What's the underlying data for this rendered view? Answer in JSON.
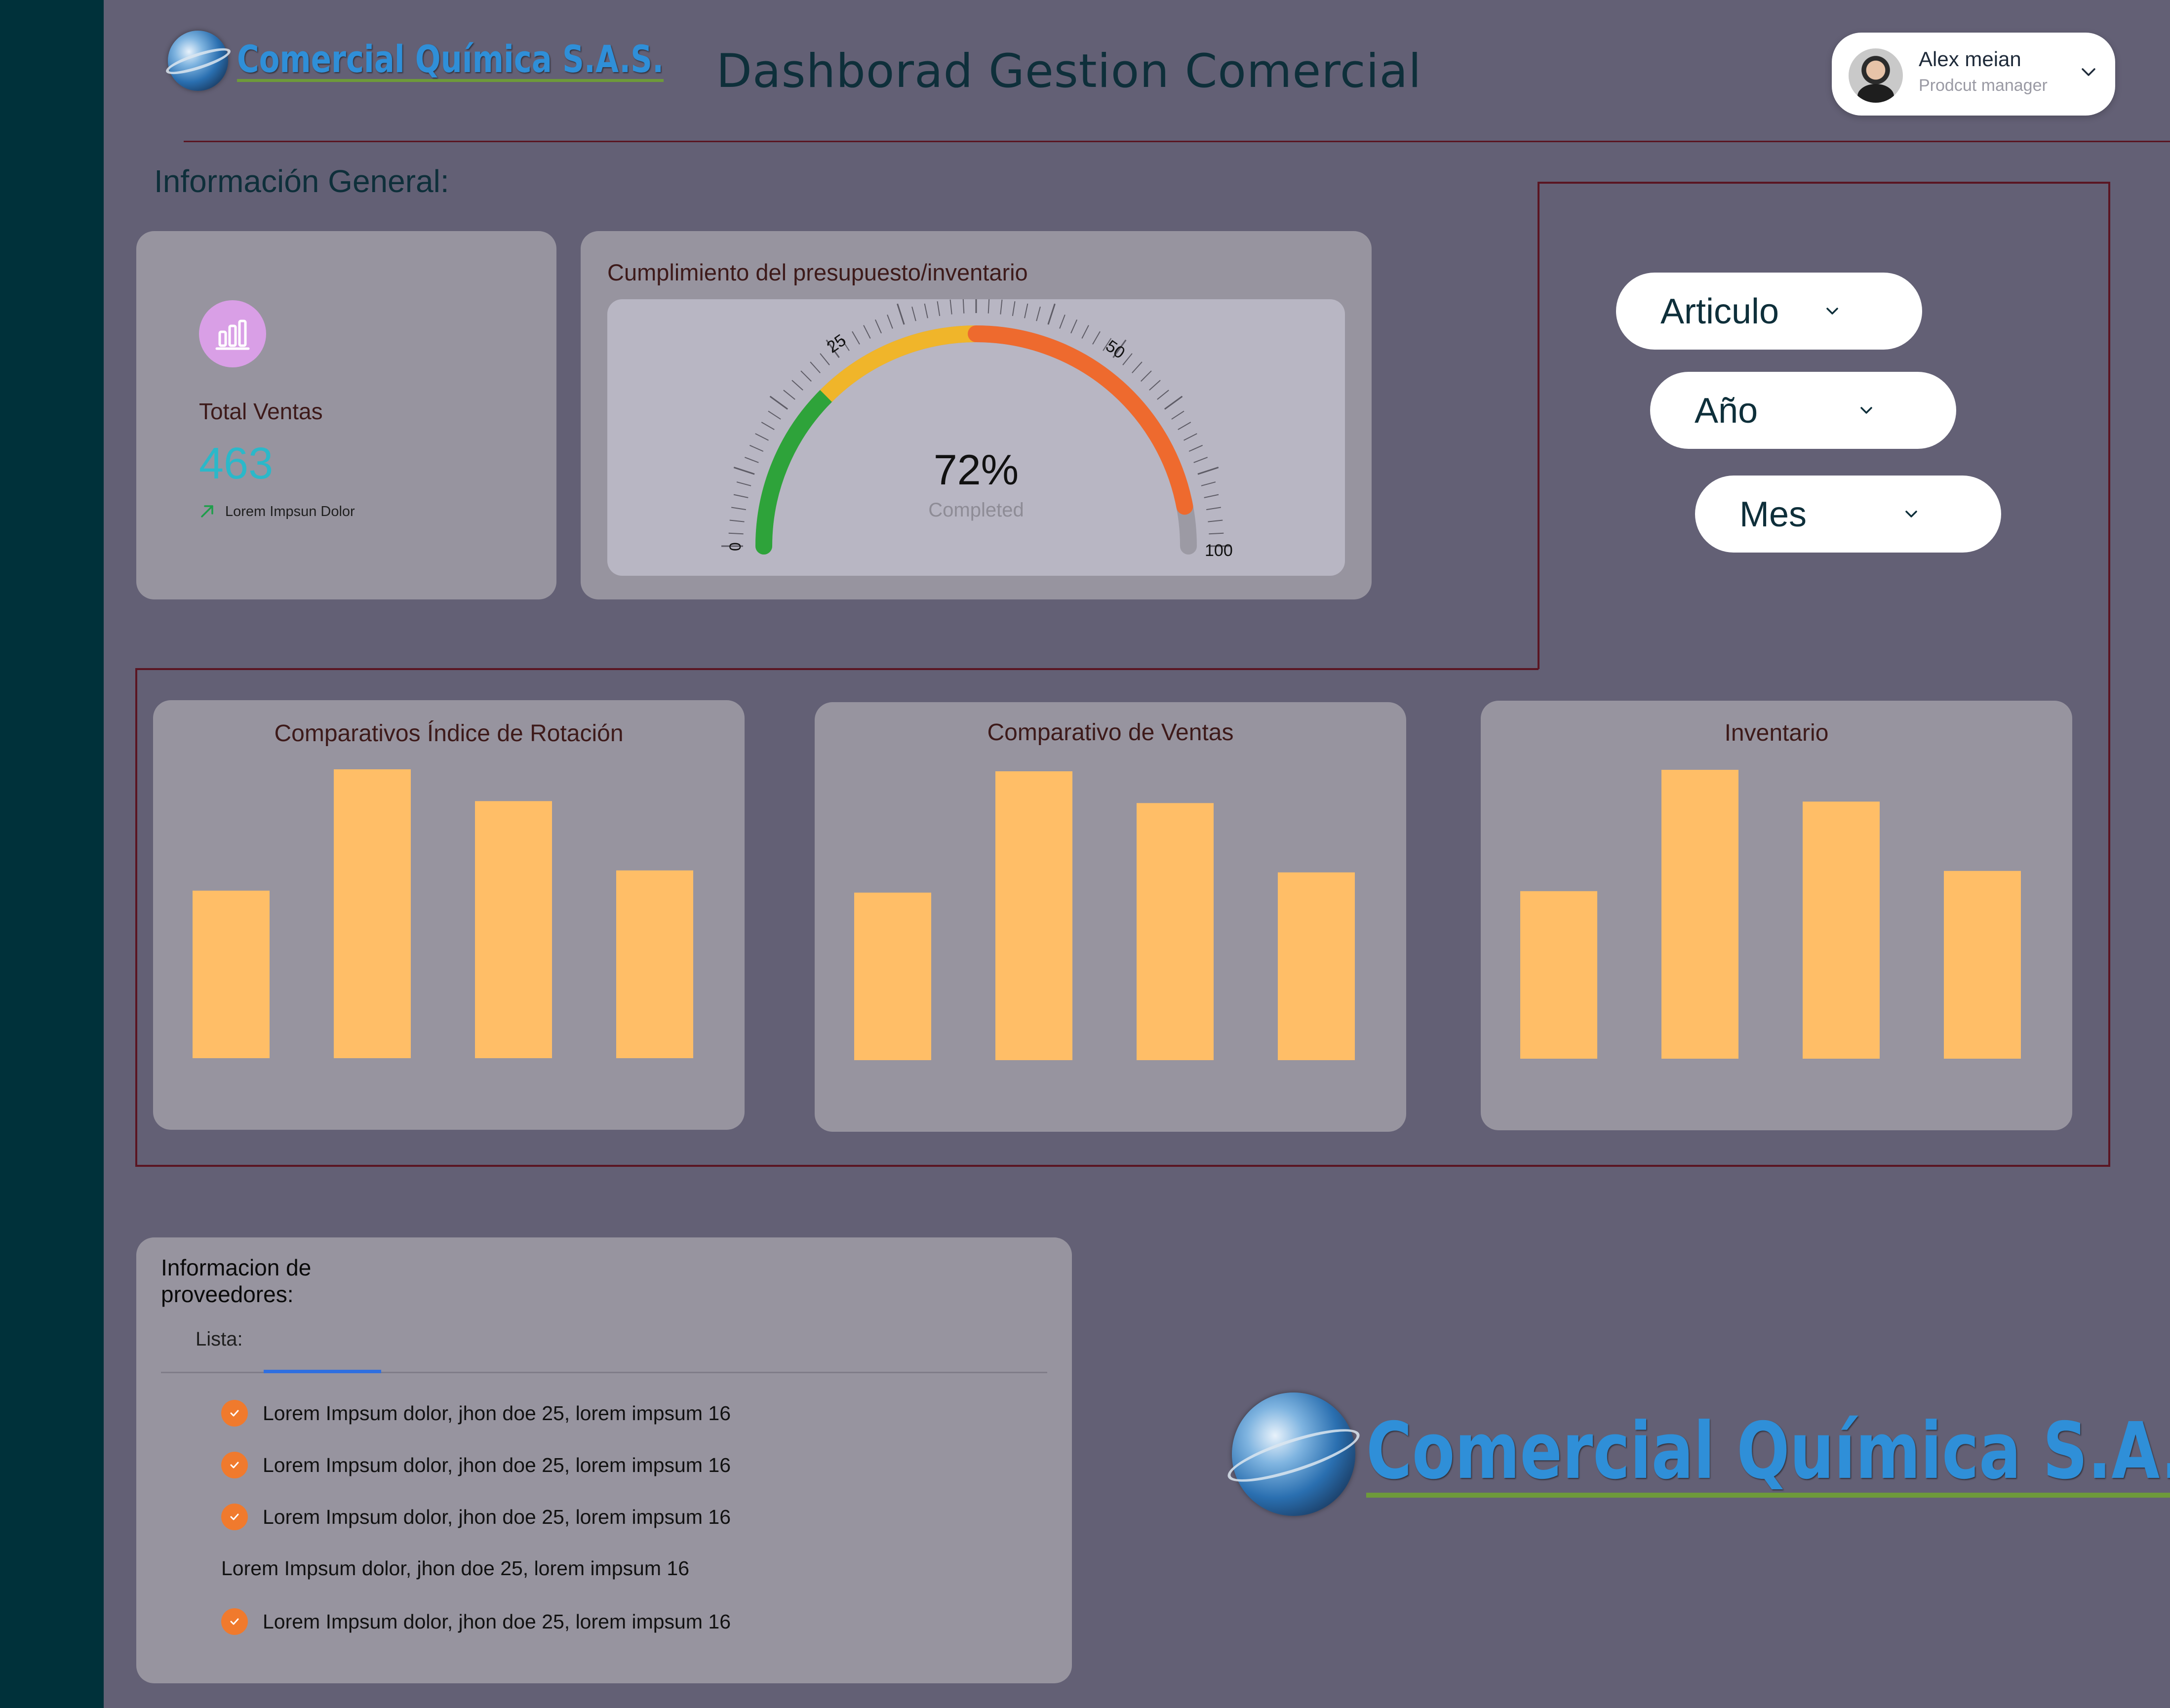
{
  "brand": {
    "name": "Comercial Química S.A.S."
  },
  "header": {
    "title": "Dashborad Gestion Comercial"
  },
  "user": {
    "name": "Alex meian",
    "role": "Prodcut manager"
  },
  "section_title": "Información General:",
  "total_sales": {
    "label": "Total Ventas",
    "value": "463",
    "trend_text": "Lorem Impsun Dolor"
  },
  "gauge": {
    "title": "Cumplimiento del presupuesto/inventario",
    "value_pct": 72,
    "value_label": "72%",
    "sub_label": "Completed",
    "ticks": [
      "0",
      "25",
      "50",
      "100"
    ]
  },
  "filters": [
    {
      "label": "Articulo"
    },
    {
      "label": "Año"
    },
    {
      "label": "Mes"
    }
  ],
  "chart_data": [
    {
      "type": "bar",
      "title": "Comparativos Índice de Rotación",
      "values": [
        58,
        100,
        89,
        65
      ],
      "color": "#ffbe67"
    },
    {
      "type": "bar",
      "title": "Comparativo de Ventas",
      "values": [
        58,
        100,
        89,
        65
      ],
      "color": "#ffbe67"
    },
    {
      "type": "bar",
      "title": "Inventario",
      "values": [
        58,
        100,
        89,
        65
      ],
      "color": "#ffbe67"
    }
  ],
  "suppliers": {
    "title": "Informacion de proveedores:",
    "tab": "Lista:",
    "items": [
      {
        "text": "Lorem Impsum dolor, jhon doe 25, lorem impsum 16",
        "checked": true
      },
      {
        "text": "Lorem Impsum dolor, jhon doe 25, lorem impsum 16",
        "checked": true
      },
      {
        "text": "Lorem Impsum dolor, jhon doe 25, lorem impsum 16",
        "checked": true
      },
      {
        "text": "Lorem Impsum dolor, jhon doe 25, lorem impsum 16",
        "checked": false
      },
      {
        "text": "Lorem Impsum dolor, jhon doe 25, lorem impsum 16",
        "checked": true
      }
    ]
  },
  "colors": {
    "background": "#636075",
    "sidebar": "#00313a",
    "card": "#97949f",
    "bar": "#ffbe67",
    "accent_border": "#5a1522"
  }
}
